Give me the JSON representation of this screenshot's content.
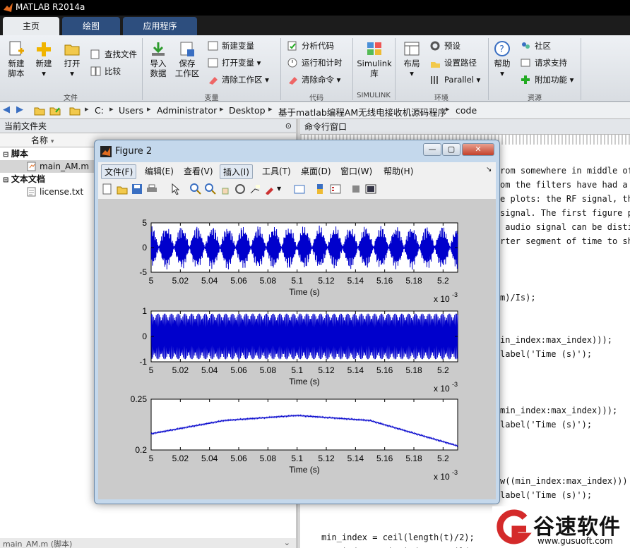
{
  "app": {
    "title": "MATLAB R2014a"
  },
  "tabs": [
    "主页",
    "绘图",
    "应用程序"
  ],
  "ribbon": {
    "big_buttons": [
      {
        "l1": "新建",
        "l2": "脚本"
      },
      {
        "l1": "新建",
        "l2": "▾"
      },
      {
        "l1": "打开",
        "l2": "▾"
      },
      {
        "l1": "导入",
        "l2": "数据"
      },
      {
        "l1": "保存",
        "l2": "工作区"
      },
      {
        "l1": "Simulink",
        "l2": "库"
      },
      {
        "l1": "布局",
        "l2": "▾"
      },
      {
        "l1": "帮助",
        "l2": "▾"
      }
    ],
    "small": [
      "查找文件",
      "比较",
      "新建变量",
      "打开变量 ▾",
      "清除工作区 ▾",
      "分析代码",
      "运行和计时",
      "清除命令 ▾",
      "预设",
      "设置路径",
      "Parallel ▾",
      "社区",
      "请求支持",
      "附加功能 ▾"
    ],
    "groups": [
      "文件",
      "变量",
      "代码",
      "SIMULINK",
      "环境",
      "资源"
    ]
  },
  "path": [
    "C:",
    "Users",
    "Administrator",
    "Desktop",
    "基于matlab编程AM无线电接收机源码程序",
    "code"
  ],
  "left_panel": {
    "title": "当前文件夹",
    "col": "名称",
    "sections": [
      {
        "name": "脚本",
        "files": [
          "main_AM.m"
        ]
      },
      {
        "name": "文本文档",
        "files": [
          "license.txt"
        ]
      }
    ],
    "status": "main_AM.m (脚本)"
  },
  "right_panel": {
    "title": "命令行窗口"
  },
  "code_lines": [
    "rom somewhere in middle of",
    "om the filters have had a c",
    "e plots: the RF signal, th",
    "signal. The first figure pl",
    " audio signal can be distin",
    "rter segment of time to sho",
    "",
    "",
    "",
    "m)/Is);",
    "",
    "",
    "in_index:max_index)));",
    "label('Time (s)');",
    "",
    "",
    "",
    "min_index:max_index)));",
    "label('Time (s)');",
    "",
    "",
    "",
    "w((min_index:max_index)))",
    "label('Time (s)');",
    "",
    "",
    "min_index = ceil(length(t)/2);",
    "max_index = min_index + ceil(150/m"
  ],
  "figure": {
    "title": "Figure 2",
    "menu": [
      "文件(F)",
      "编辑(E)",
      "查看(V)",
      "插入(I)",
      "工具(T)",
      "桌面(D)",
      "窗口(W)",
      "帮助(H)"
    ]
  },
  "chart_data": [
    {
      "type": "line",
      "title": "",
      "xlabel": "Time (s)",
      "ylabel": "",
      "xlim": [
        5,
        5.21
      ],
      "ylim": [
        -5,
        5
      ],
      "x_multiplier": "x 10-3",
      "xticks": [
        "5",
        "5.02",
        "5.04",
        "5.06",
        "5.08",
        "5.1",
        "5.12",
        "5.14",
        "5.16",
        "5.18",
        "5.2"
      ],
      "yticks": [
        "5",
        "0",
        "-5"
      ],
      "series": [
        {
          "color": "#0000cc",
          "shape": "AM-modulated RF signal, envelope amplitude ~4.5, peaks every ~0.01"
        }
      ]
    },
    {
      "type": "line",
      "title": "",
      "xlabel": "Time (s)",
      "ylabel": "",
      "xlim": [
        5,
        5.21
      ],
      "ylim": [
        -1,
        1
      ],
      "x_multiplier": "x 10-3",
      "xticks": [
        "5",
        "5.02",
        "5.04",
        "5.06",
        "5.08",
        "5.1",
        "5.12",
        "5.14",
        "5.16",
        "5.18",
        "5.2"
      ],
      "yticks": [
        "1",
        "0",
        "-1"
      ],
      "series": [
        {
          "color": "#0000cc",
          "shape": "carrier oscillation amplitude ~0.9"
        }
      ]
    },
    {
      "type": "line",
      "title": "",
      "xlabel": "Time (s)",
      "ylabel": "",
      "xlim": [
        5,
        5.21
      ],
      "ylim": [
        0.2,
        0.25
      ],
      "x_multiplier": "x 10-3",
      "xticks": [
        "5",
        "5.02",
        "5.04",
        "5.06",
        "5.08",
        "5.1",
        "5.12",
        "5.14",
        "5.16",
        "5.18",
        "5.2"
      ],
      "yticks": [
        "0.25",
        "0.2"
      ],
      "series": [
        {
          "color": "#0000cc",
          "x": [
            5,
            5.05,
            5.1,
            5.15,
            5.21
          ],
          "y": [
            0.216,
            0.229,
            0.234,
            0.229,
            0.204
          ]
        }
      ]
    }
  ],
  "watermark": {
    "name": "谷速软件",
    "url": "www.gusuoft.com"
  }
}
